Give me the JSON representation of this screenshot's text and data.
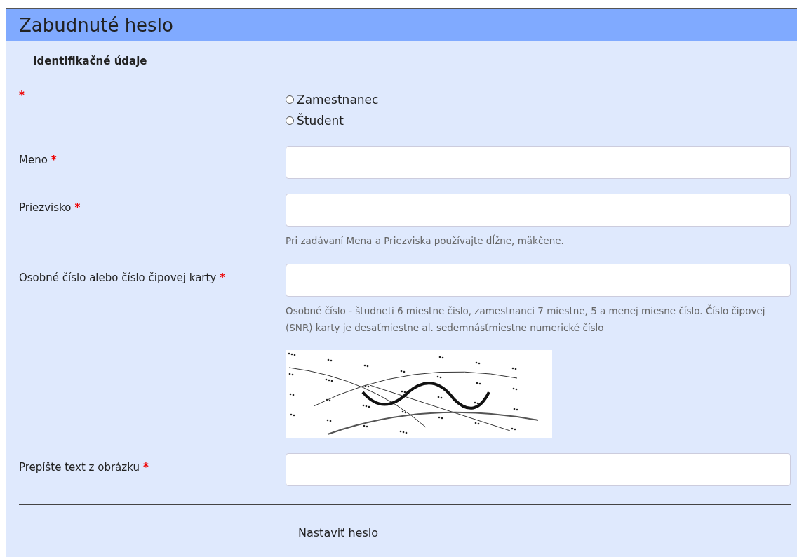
{
  "title": "Zabudnuté heslo",
  "section": "Identifikačné údaje",
  "fields": [
    {
      "kind": "radio",
      "required": true,
      "options": [
        {
          "label": "Zamestnanec",
          "selected": false
        },
        {
          "label": "Študent",
          "selected": false
        }
      ]
    },
    {
      "kind": "text",
      "label": "Meno",
      "required": true
    },
    {
      "kind": "text",
      "label": "Priezvisko",
      "required": true,
      "hint": "Pri zadávaní Mena a Priezviska používajte dĺžne, mäkčene."
    },
    {
      "kind": "text",
      "label": "Osobné číslo alebo číslo čipovej karty",
      "required": true,
      "hint": "Osobné číslo - študneti 6 miestne čislo, zamestnanci 7 miestne, 5 a menej miesne číslo. Číslo čipovej (SNR) karty je desaťmiestne al. sedemnásťmiestne numerické číslo"
    },
    {
      "kind": "captcha"
    },
    {
      "kind": "text",
      "label": "Prepíšte text z obrázku",
      "required": true
    }
  ],
  "submit": "Nastaviť heslo",
  "required_mark": "*"
}
